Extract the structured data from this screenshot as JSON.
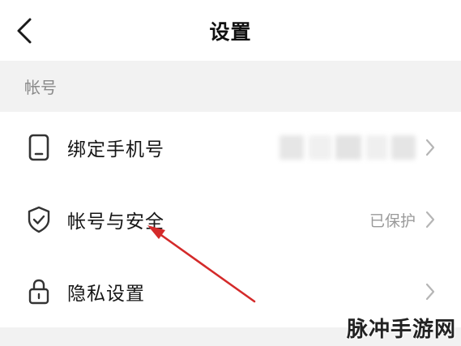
{
  "header": {
    "title": "设置"
  },
  "section": {
    "title": "帐号"
  },
  "rows": [
    {
      "label": "绑定手机号",
      "value": "",
      "icon": "phone-icon"
    },
    {
      "label": "帐号与安全",
      "value": "已保护",
      "icon": "shield-check-icon"
    },
    {
      "label": "隐私设置",
      "value": "",
      "icon": "lock-icon"
    }
  ],
  "watermark": "脉冲手游网",
  "colors": {
    "accent_arrow": "#d42a2a",
    "section_bg": "#f2f2f2",
    "muted_text": "#9a9a9a"
  }
}
